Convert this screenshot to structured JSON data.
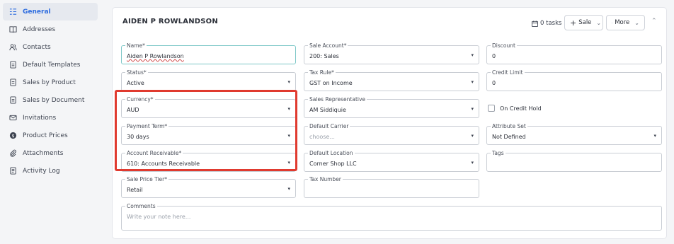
{
  "sidebar": {
    "items": [
      {
        "label": "General",
        "icon": "general-list-icon",
        "active": true
      },
      {
        "label": "Addresses",
        "icon": "book-icon",
        "active": false
      },
      {
        "label": "Contacts",
        "icon": "contacts-icon",
        "active": false
      },
      {
        "label": "Default Templates",
        "icon": "document-icon",
        "active": false
      },
      {
        "label": "Sales by Product",
        "icon": "document-icon",
        "active": false
      },
      {
        "label": "Sales by Document",
        "icon": "document-icon",
        "active": false
      },
      {
        "label": "Invitations",
        "icon": "mail-icon",
        "active": false
      },
      {
        "label": "Product Prices",
        "icon": "dollar-icon",
        "active": false
      },
      {
        "label": "Attachments",
        "icon": "paperclip-icon",
        "active": false
      },
      {
        "label": "Activity Log",
        "icon": "log-icon",
        "active": false
      }
    ]
  },
  "header": {
    "title": "AIDEN P ROWLANDSON",
    "tasks_label": "0 tasks",
    "sale_label": "Sale",
    "more_label": "More"
  },
  "form": {
    "name": {
      "label": "Name*",
      "value": "Aiden P Rowlandson"
    },
    "sale_account": {
      "label": "Sale Account*",
      "value": "200: Sales"
    },
    "discount": {
      "label": "Discount",
      "value": "0"
    },
    "status": {
      "label": "Status*",
      "value": "Active"
    },
    "tax_rule": {
      "label": "Tax Rule*",
      "value": "GST on Income"
    },
    "credit_limit": {
      "label": "Credit Limit",
      "value": "0"
    },
    "currency": {
      "label": "Currency*",
      "value": "AUD"
    },
    "sales_rep": {
      "label": "Sales Representative",
      "value": "AM Siddiquie"
    },
    "on_credit_hold": {
      "label": "On Credit Hold",
      "checked": false
    },
    "payment_term": {
      "label": "Payment Term*",
      "value": "30 days"
    },
    "default_carrier": {
      "label": "Default Carrier",
      "placeholder": "choose..."
    },
    "attribute_set": {
      "label": "Attribute Set",
      "value": "Not Defined"
    },
    "account_receivable": {
      "label": "Account Receivable*",
      "value": "610: Accounts Receivable"
    },
    "default_location": {
      "label": "Default Location",
      "value": "Corner Shop LLC"
    },
    "tags": {
      "label": "Tags",
      "value": ""
    },
    "sale_price_tier": {
      "label": "Sale Price Tier*",
      "value": "Retail"
    },
    "tax_number": {
      "label": "Tax Number",
      "value": ""
    },
    "comments": {
      "label": "Comments",
      "placeholder": "Write your note here..."
    }
  },
  "colors": {
    "accent": "#2d6cdf",
    "highlight": "#e03a2f",
    "focus_border": "#7ec8c8"
  }
}
